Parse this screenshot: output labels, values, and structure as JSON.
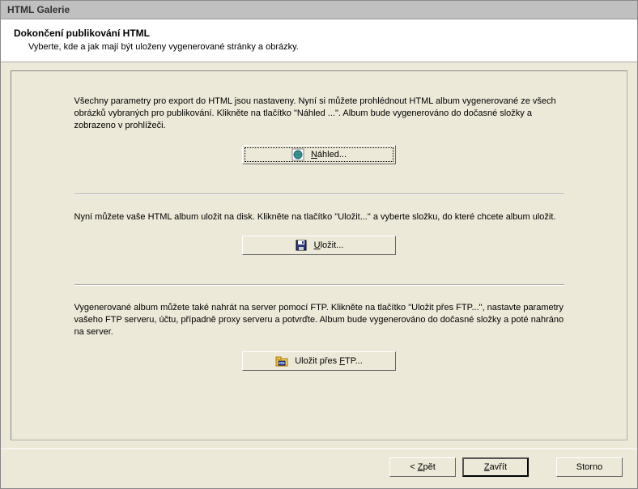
{
  "window": {
    "title": "HTML Galerie"
  },
  "header": {
    "title": "Dokončení publikování HTML",
    "subtitle": "Vyberte, kde a jak mají být uloženy vygenerované stránky a obrázky."
  },
  "sections": {
    "preview": {
      "text": "Všechny parametry pro export do HTML jsou nastaveny. Nyní si můžete prohlédnout HTML album vygenerované ze všech obrázků vybraných pro publikování. Klikněte na tlačítko \"Náhled ...\". Album bude vygenerováno do dočasné složky a zobrazeno v prohlížeči.",
      "button_label": "Náhled..."
    },
    "save": {
      "text": "Nyní můžete vaše HTML album uložit na disk. Klikněte na tlačítko \"Uložit...\" a vyberte složku, do které chcete album uložit.",
      "button_label": "Uložit..."
    },
    "ftp": {
      "text": "Vygenerované album můžete také nahrát na server pomocí FTP. Klikněte na tlačítko \"Uložit přes FTP...\", nastavte parametry vašeho FTP serveru, účtu, případně proxy serveru a potvrďte. Album bude vygenerováno do dočasné složky a poté nahráno na server.",
      "button_label": "Uložit přes FTP..."
    }
  },
  "footer": {
    "back": "< Zpět",
    "close": "Zavřít",
    "cancel": "Storno"
  }
}
